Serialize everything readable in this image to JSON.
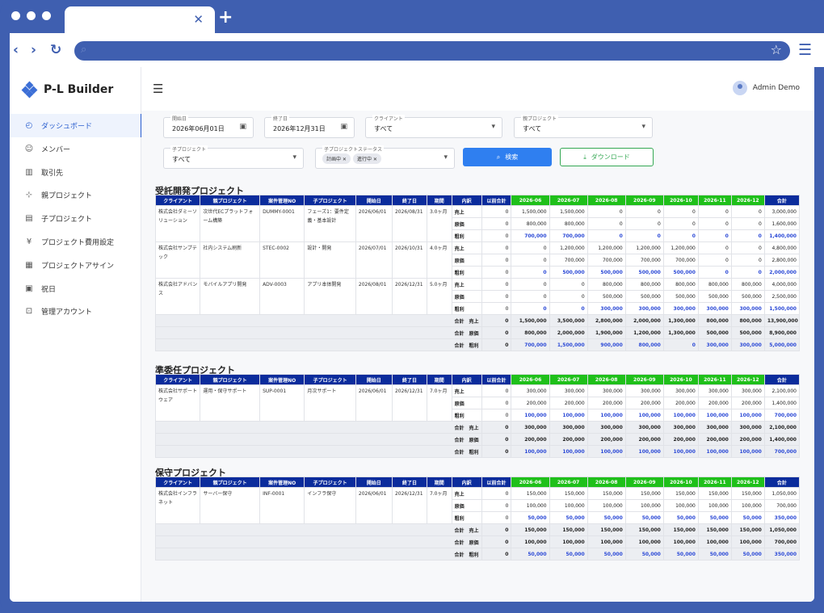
{
  "user": {
    "name": "Admin Demo"
  },
  "brand": {
    "name": "P-L Builder"
  },
  "sidebar": [
    {
      "label": "ダッシュボード",
      "icon": "dashboard-icon",
      "glyph": "◴",
      "active": true
    },
    {
      "label": "メンバー",
      "icon": "person-icon",
      "glyph": "☺",
      "active": false
    },
    {
      "label": "取引先",
      "icon": "building-icon",
      "glyph": "▥",
      "active": false
    },
    {
      "label": "親プロジェクト",
      "icon": "hierarchy-icon",
      "glyph": "⊹",
      "active": false
    },
    {
      "label": "子プロジェクト",
      "icon": "document-icon",
      "glyph": "▤",
      "active": false
    },
    {
      "label": "プロジェクト費用設定",
      "icon": "yen-icon",
      "glyph": "¥",
      "active": false
    },
    {
      "label": "プロジェクトアサイン",
      "icon": "calendar-icon",
      "glyph": "▦",
      "active": false
    },
    {
      "label": "祝日",
      "icon": "gift-icon",
      "glyph": "▣",
      "active": false
    },
    {
      "label": "管理アカウント",
      "icon": "lock-icon",
      "glyph": "⊡",
      "active": false
    }
  ],
  "filters": {
    "start": {
      "label": "開始日",
      "value": "2026年06月01日"
    },
    "end": {
      "label": "終了日",
      "value": "2026年12月31日"
    },
    "client": {
      "label": "クライアント",
      "value": "すべて"
    },
    "parent": {
      "label": "親プロジェクト",
      "value": "すべて"
    },
    "child": {
      "label": "子プロジェクト",
      "value": "すべて"
    },
    "status": {
      "label": "子プロジェクトステータス",
      "chips": [
        "計画中",
        "進行中"
      ]
    },
    "search_label": "検索",
    "download_label": "ダウンロード"
  },
  "sections": [
    {
      "title": "受託開発プロジェクト",
      "headers": [
        "クライアント",
        "親プロジェクト",
        "案件管理NO",
        "子プロジェクト",
        "開始日",
        "終了日",
        "期間",
        "内訳",
        "以前合計",
        "2026-06",
        "2026-07",
        "2026-08",
        "2026-09",
        "2026-10",
        "2026-11",
        "2026-12",
        "合計"
      ],
      "projects": [
        {
          "client": "株式会社ダミーソリューション",
          "parent": "次世代ECプラットフォーム構築",
          "no": "DUMMY-0001",
          "child": "フェーズ1：要件定義・基本設計",
          "start": "2026/06/01",
          "end": "2026/08/31",
          "period": "3.0ヶ月",
          "rows": [
            [
              "売上",
              "0",
              "1,500,000",
              "1,500,000",
              "0",
              "0",
              "0",
              "0",
              "0",
              "3,000,000"
            ],
            [
              "原価",
              "0",
              "800,000",
              "800,000",
              "0",
              "0",
              "0",
              "0",
              "0",
              "1,600,000"
            ],
            [
              "粗利",
              "0",
              "700,000",
              "700,000",
              "0",
              "0",
              "0",
              "0",
              "0",
              "1,400,000"
            ]
          ]
        },
        {
          "client": "株式会社サンプテック",
          "parent": "社内システム刷新",
          "no": "STEC-0002",
          "child": "設計・開発",
          "start": "2026/07/01",
          "end": "2026/10/31",
          "period": "4.0ヶ月",
          "rows": [
            [
              "売上",
              "0",
              "0",
              "1,200,000",
              "1,200,000",
              "1,200,000",
              "1,200,000",
              "0",
              "0",
              "4,800,000"
            ],
            [
              "原価",
              "0",
              "0",
              "700,000",
              "700,000",
              "700,000",
              "700,000",
              "0",
              "0",
              "2,800,000"
            ],
            [
              "粗利",
              "0",
              "0",
              "500,000",
              "500,000",
              "500,000",
              "500,000",
              "0",
              "0",
              "2,000,000"
            ]
          ]
        },
        {
          "client": "株式会社アドバンス",
          "parent": "モバイルアプリ開発",
          "no": "ADV-0003",
          "child": "アプリ本体開発",
          "start": "2026/08/01",
          "end": "2026/12/31",
          "period": "5.0ヶ月",
          "rows": [
            [
              "売上",
              "0",
              "0",
              "0",
              "800,000",
              "800,000",
              "800,000",
              "800,000",
              "800,000",
              "4,000,000"
            ],
            [
              "原価",
              "0",
              "0",
              "0",
              "500,000",
              "500,000",
              "500,000",
              "500,000",
              "500,000",
              "2,500,000"
            ],
            [
              "粗利",
              "0",
              "0",
              "0",
              "300,000",
              "300,000",
              "300,000",
              "300,000",
              "300,000",
              "1,500,000"
            ]
          ]
        }
      ],
      "totals": [
        {
          "label": "合計　売上",
          "values": [
            "0",
            "1,500,000",
            "3,500,000",
            "2,800,000",
            "2,000,000",
            "1,300,000",
            "800,000",
            "800,000",
            "13,900,000"
          ]
        },
        {
          "label": "合計　原価",
          "values": [
            "0",
            "800,000",
            "2,000,000",
            "1,900,000",
            "1,200,000",
            "1,300,000",
            "500,000",
            "500,000",
            "8,900,000"
          ]
        },
        {
          "label": "合計　粗利",
          "values": [
            "0",
            "700,000",
            "1,500,000",
            "900,000",
            "800,000",
            "0",
            "300,000",
            "300,000",
            "5,000,000"
          ]
        }
      ]
    },
    {
      "title": "準委任プロジェクト",
      "headers": [
        "クライアント",
        "親プロジェクト",
        "案件管理NO",
        "子プロジェクト",
        "開始日",
        "終了日",
        "期間",
        "内訳",
        "以前合計",
        "2026-06",
        "2026-07",
        "2026-08",
        "2026-09",
        "2026-10",
        "2026-11",
        "2026-12",
        "合計"
      ],
      "projects": [
        {
          "client": "株式会社サポートウェア",
          "parent": "運用・保守サポート",
          "no": "SUP-0001",
          "child": "月次サポート",
          "start": "2026/06/01",
          "end": "2026/12/31",
          "period": "7.0ヶ月",
          "rows": [
            [
              "売上",
              "0",
              "300,000",
              "300,000",
              "300,000",
              "300,000",
              "300,000",
              "300,000",
              "300,000",
              "2,100,000"
            ],
            [
              "原価",
              "0",
              "200,000",
              "200,000",
              "200,000",
              "200,000",
              "200,000",
              "200,000",
              "200,000",
              "1,400,000"
            ],
            [
              "粗利",
              "0",
              "100,000",
              "100,000",
              "100,000",
              "100,000",
              "100,000",
              "100,000",
              "100,000",
              "700,000"
            ]
          ]
        }
      ],
      "totals": [
        {
          "label": "合計　売上",
          "values": [
            "0",
            "300,000",
            "300,000",
            "300,000",
            "300,000",
            "300,000",
            "300,000",
            "300,000",
            "2,100,000"
          ]
        },
        {
          "label": "合計　原価",
          "values": [
            "0",
            "200,000",
            "200,000",
            "200,000",
            "200,000",
            "200,000",
            "200,000",
            "200,000",
            "1,400,000"
          ]
        },
        {
          "label": "合計　粗利",
          "values": [
            "0",
            "100,000",
            "100,000",
            "100,000",
            "100,000",
            "100,000",
            "100,000",
            "100,000",
            "700,000"
          ]
        }
      ]
    },
    {
      "title": "保守プロジェクト",
      "headers": [
        "クライアント",
        "親プロジェクト",
        "案件管理NO",
        "子プロジェクト",
        "開始日",
        "終了日",
        "期間",
        "内訳",
        "以前合計",
        "2026-06",
        "2026-07",
        "2026-08",
        "2026-09",
        "2026-10",
        "2026-11",
        "2026-12",
        "合計"
      ],
      "projects": [
        {
          "client": "株式会社インフラネット",
          "parent": "サーバー保守",
          "no": "INF-0001",
          "child": "インフラ保守",
          "start": "2026/06/01",
          "end": "2026/12/31",
          "period": "7.0ヶ月",
          "rows": [
            [
              "売上",
              "0",
              "150,000",
              "150,000",
              "150,000",
              "150,000",
              "150,000",
              "150,000",
              "150,000",
              "1,050,000"
            ],
            [
              "原価",
              "0",
              "100,000",
              "100,000",
              "100,000",
              "100,000",
              "100,000",
              "100,000",
              "100,000",
              "700,000"
            ],
            [
              "粗利",
              "0",
              "50,000",
              "50,000",
              "50,000",
              "50,000",
              "50,000",
              "50,000",
              "50,000",
              "350,000"
            ]
          ]
        }
      ],
      "totals": [
        {
          "label": "合計　売上",
          "values": [
            "0",
            "150,000",
            "150,000",
            "150,000",
            "150,000",
            "150,000",
            "150,000",
            "150,000",
            "1,050,000"
          ]
        },
        {
          "label": "合計　原価",
          "values": [
            "0",
            "100,000",
            "100,000",
            "100,000",
            "100,000",
            "100,000",
            "100,000",
            "100,000",
            "700,000"
          ]
        },
        {
          "label": "合計　粗利",
          "values": [
            "0",
            "50,000",
            "50,000",
            "50,000",
            "50,000",
            "50,000",
            "50,000",
            "50,000",
            "350,000"
          ]
        }
      ]
    }
  ],
  "colors": {
    "header_blue": "#0b2c9c",
    "month_green": "#1fc01a",
    "profit_blue": "#2b49d6",
    "frame": "#3f5fb0"
  }
}
